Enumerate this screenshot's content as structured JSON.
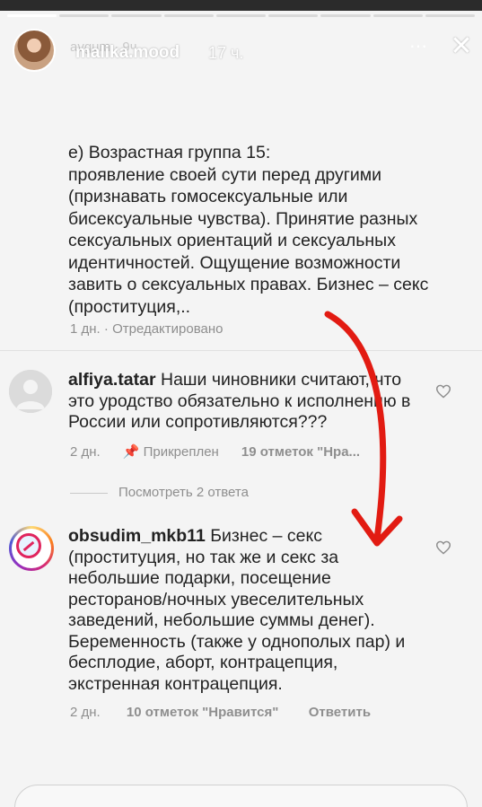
{
  "story": {
    "progress_segments": 9,
    "progress_active": 1,
    "ghost_user": "avgum · 9ч",
    "username": "malika.mood",
    "time": "17 ч.",
    "more_icon": "ellipsis-icon",
    "close_icon": "close-icon"
  },
  "caption": {
    "text": "е) Возрастная группа 15:\nпроявление своей сути перед другими (признавать гомосексуальные или бисексуальные чувства). Принятие разных сексуальных ориентаций и сексуальных идентичностей. Ощущение возможности завить о сексуальных правах. Бизнес – секс (проституция,..",
    "age": "1 дн.",
    "separator": "·",
    "edited": "Отредактировано"
  },
  "comments": [
    {
      "user": "alfiya.tatar",
      "text": "Наши чиновники считают, что это уродство обязательно к исполнению в России или сопротивляются???",
      "age": "2 дн.",
      "pin_icon": "pin-icon",
      "pinned": "Прикреплен",
      "likes": "19 отметок \"Нра..."
    },
    {
      "user": "obsudim_mkb11",
      "text": "Бизнес – секс (проституция, но так же и секс за небольшие подарки, посещение ресторанов/ночных увеселительных заведений, небольшие суммы денег). Беременность (также у однополых пар) и бесплодие, аборт, контрацепция, экстренная контрацепция.",
      "age": "2 дн.",
      "likes": "10 отметок \"Нравится\"",
      "reply": "Ответить"
    }
  ],
  "view_replies": "Посмотреть 2 ответа",
  "colors": {
    "arrow": "#e21b12",
    "meta_text": "#8e8e8e",
    "body_text": "#222222"
  }
}
